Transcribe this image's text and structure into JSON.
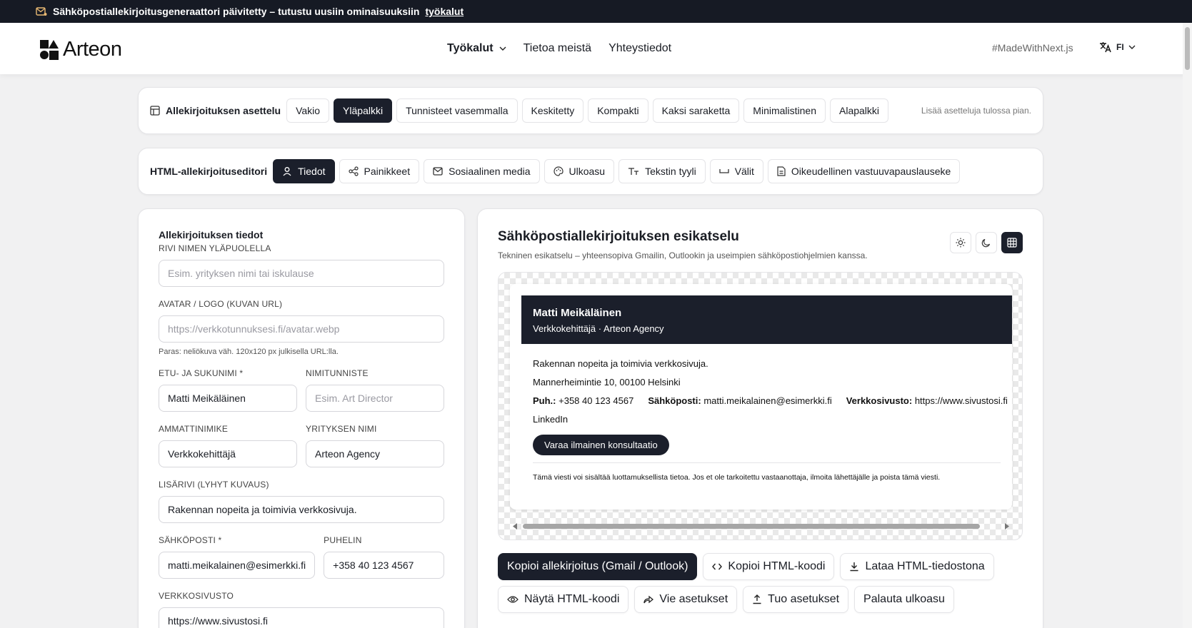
{
  "announcement": {
    "text": "Sähköpostiallekirjoitusgeneraattori päivitetty – tutustu uusiin ominaisuuksiin",
    "link": "työkalut"
  },
  "header": {
    "logo": "Arteon",
    "nav": [
      {
        "label": "Työkalut"
      },
      {
        "label": "Tietoa meistä"
      },
      {
        "label": "Yhteystiedot"
      }
    ],
    "made_with": "#MadeWithNext.js",
    "language": "FI"
  },
  "layout_selector": {
    "label": "Allekirjoituksen asettelu",
    "options": [
      "Vakio",
      "Yläpalkki",
      "Tunnisteet vasemmalla",
      "Keskitetty",
      "Kompakti",
      "Kaksi saraketta",
      "Minimalistinen",
      "Alapalkki"
    ],
    "active": "Yläpalkki",
    "note": "Lisää asetteluja tulossa pian."
  },
  "editor_tabs": {
    "label": "HTML-allekirjoituseditori",
    "tabs": [
      "Tiedot",
      "Painikkeet",
      "Sosiaalinen media",
      "Ulkoasu",
      "Tekstin tyyli",
      "Välit",
      "Oikeudellinen vastuuvapauslauseke"
    ],
    "active": "Tiedot"
  },
  "form": {
    "title": "Allekirjoituksen tiedot",
    "above_name": {
      "label": "RIVI NIMEN YLÄPUOLELLA",
      "placeholder": "Esim. yrityksen nimi tai iskulause",
      "value": ""
    },
    "avatar": {
      "label": "AVATAR / LOGO (KUVAN URL)",
      "placeholder": "https://verkkotunnuksesi.fi/avatar.webp",
      "value": "",
      "hint": "Paras: neliökuva väh. 120x120 px julkisella URL:lla."
    },
    "full_name": {
      "label": "ETU- JA SUKUNIMI *",
      "value": "Matti Meikäläinen"
    },
    "title_tag": {
      "label": "NIMITUNNISTE",
      "placeholder": "Esim. Art Director",
      "value": ""
    },
    "job_title": {
      "label": "AMMATTINIMIKE",
      "value": "Verkkokehittäjä"
    },
    "company": {
      "label": "YRITYKSEN NIMI",
      "value": "Arteon Agency"
    },
    "extra_line": {
      "label": "LISÄRIVI (LYHYT KUVAUS)",
      "value": "Rakennan nopeita ja toimivia verkkosivuja."
    },
    "email": {
      "label": "SÄHKÖPOSTI *",
      "value": "matti.meikalainen@esimerkki.fi"
    },
    "phone": {
      "label": "PUHELIN",
      "value": "+358 40 123 4567"
    },
    "website": {
      "label": "VERKKOSIVUSTO",
      "value": "https://www.sivustosi.fi"
    }
  },
  "preview": {
    "title": "Sähköpostiallekirjoituksen esikatselu",
    "subtitle": "Tekninen esikatselu – yhteensopiva Gmailin, Outlookin ja useimpien sähköpostiohjelmien kanssa.",
    "signature": {
      "name": "Matti Meikäläinen",
      "role_line": "Verkkokehittäjä · Arteon Agency",
      "description": "Rakennan nopeita ja toimivia verkkosivuja.",
      "address": "Mannerheimintie 10, 00100 Helsinki",
      "phone_label": "Puh.:",
      "phone": "+358 40 123 4567",
      "email_label": "Sähköposti:",
      "email": "matti.meikalainen@esimerkki.fi",
      "website_label": "Verkkosivusto:",
      "website": "https://www.sivustosi.fi",
      "social": "LinkedIn",
      "cta": "Varaa ilmainen konsultaatio",
      "legal": "Tämä viesti voi sisältää luottamuksellista tietoa. Jos et ole tarkoitettu vastaanottaja, ilmoita lähettäjälle ja poista tämä viesti."
    }
  },
  "actions": {
    "copy_signature": "Kopioi allekirjoitus (Gmail / Outlook)",
    "copy_html": "Kopioi HTML-koodi",
    "download_html": "Lataa HTML-tiedostona",
    "show_html": "Näytä HTML-koodi",
    "export_settings": "Vie asetukset",
    "import_settings": "Tuo asetukset",
    "reset_layout": "Palauta ulkoasu"
  }
}
